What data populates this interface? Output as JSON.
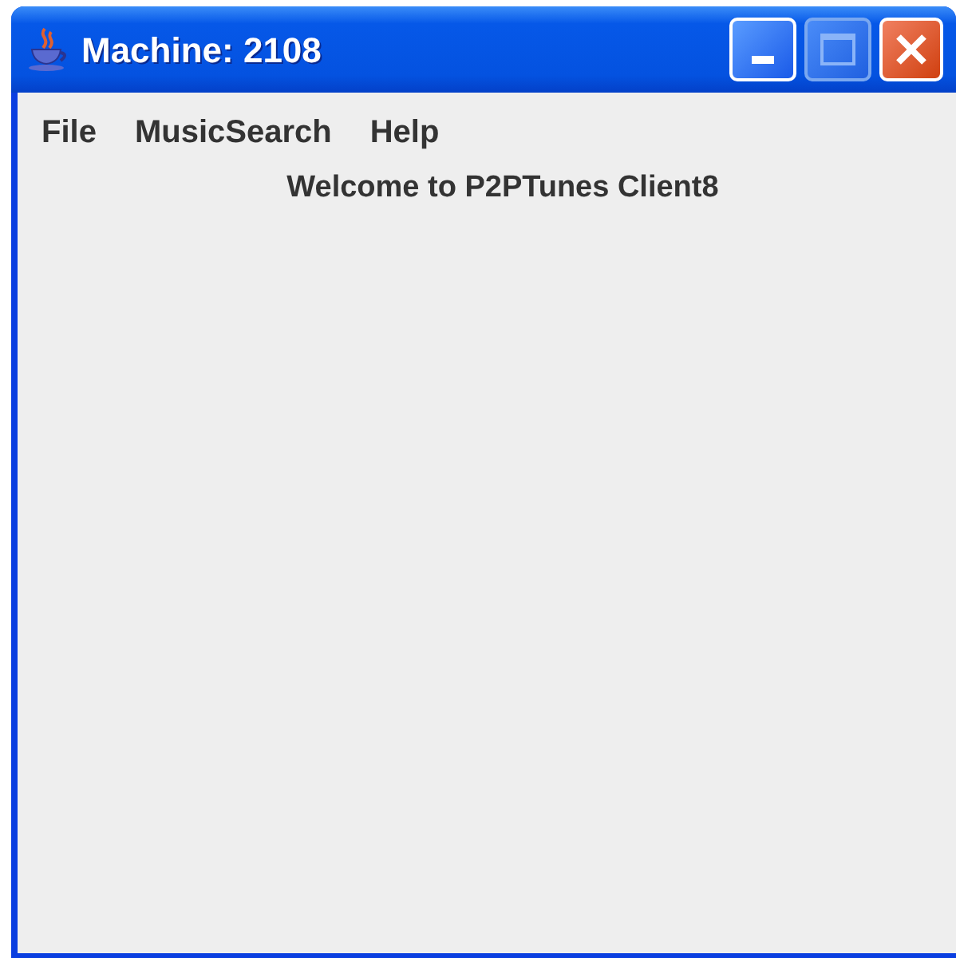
{
  "window": {
    "title": "Machine: 2108"
  },
  "menu": [
    {
      "label": "File"
    },
    {
      "label": "MusicSearch"
    },
    {
      "label": "Help"
    }
  ],
  "welcome": "Welcome to P2PTunes Client8"
}
